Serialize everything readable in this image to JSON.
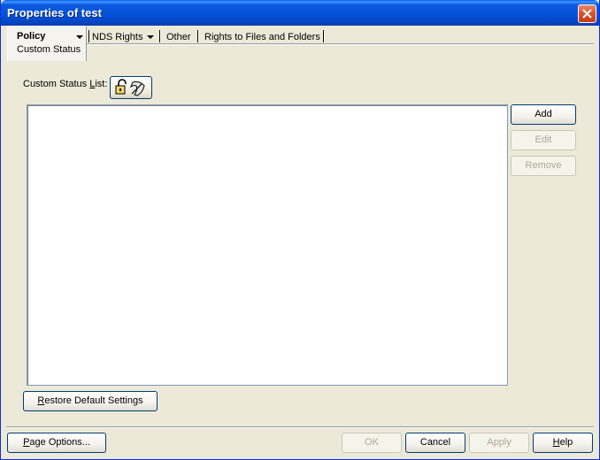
{
  "window": {
    "title": "Properties of test"
  },
  "tabs": {
    "policy": {
      "label": "Policy",
      "sub_label": "Custom Status"
    },
    "nds_rights": {
      "label": "NDS Rights"
    },
    "other": {
      "label": "Other"
    },
    "rights_files": {
      "label": "Rights to Files and Folders"
    }
  },
  "content": {
    "list_label_pre": "Custom Status ",
    "list_label_underline": "L",
    "list_label_post": "ist:",
    "add_label": "Add",
    "edit_label": "Edit",
    "remove_label": "Remove",
    "restore_underline": "R",
    "restore_rest": "estore Default Settings"
  },
  "footer": {
    "page_options_underline": "P",
    "page_options_rest": "age Options...",
    "ok_label": "OK",
    "cancel_label": "Cancel",
    "apply_label": "Apply",
    "help_underline": "H",
    "help_rest": "elp"
  },
  "icons": {
    "close": "close-icon",
    "lock": "padlock-icon",
    "inherit": "inherit-shield-icon",
    "dropdown": "dropdown-arrow-icon"
  },
  "colors": {
    "titlebar": "#0551d6",
    "close_button": "#d9532b",
    "face": "#ece9d8",
    "disabled_text": "#aca899"
  }
}
